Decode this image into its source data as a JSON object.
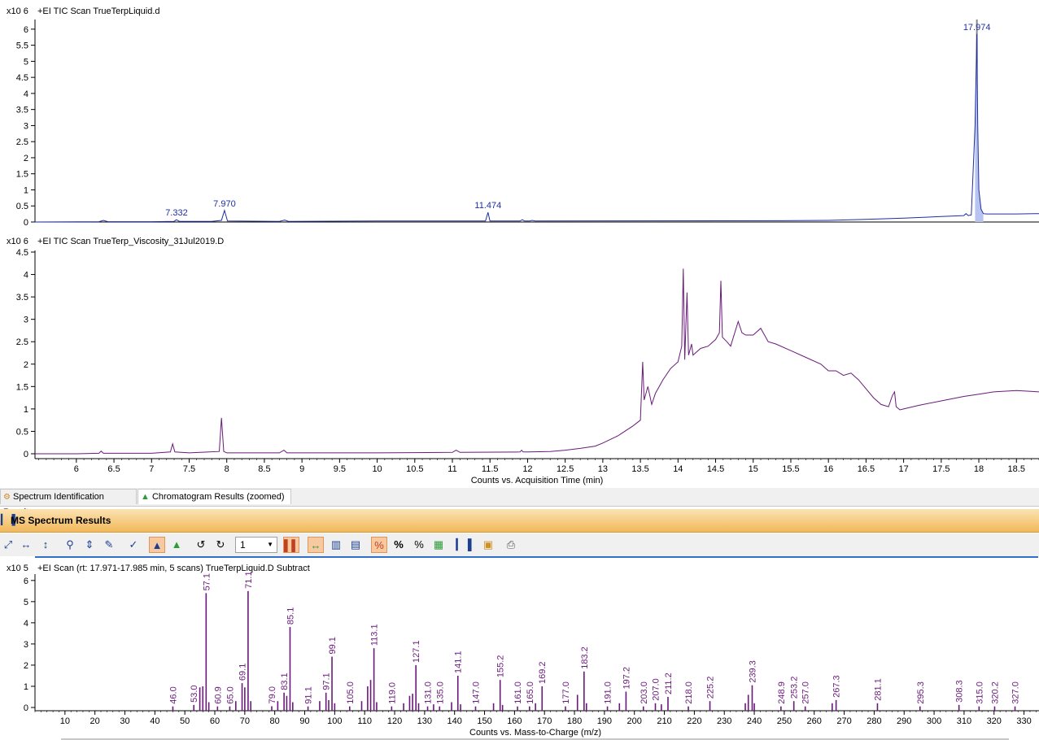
{
  "top_panel": {
    "exponent_label": "x10 6",
    "title": "+EI TIC Scan TrueTerpLiquid.d"
  },
  "mid_panel": {
    "exponent_label": "x10 6",
    "title": "+EI TIC Scan TrueTerp_Viscosity_31Jul2019.D",
    "xlabel": "Counts vs. Acquisition Time (min)"
  },
  "tabs": [
    {
      "label": "Spectrum Identification Results",
      "icon": "spectrum-id-icon"
    },
    {
      "label": "Chromatogram Results (zoomed)",
      "icon": "chromatogram-peak-icon"
    }
  ],
  "ms_panel": {
    "title": "MS Spectrum Results",
    "zoom_value": "1",
    "exponent_label": "x10 5",
    "scan_title": "+EI Scan (rt: 17.971-17.985 min, 5 scans) TrueTerpLiquid.D  Subtract",
    "xlabel": "Counts vs. Mass-to-Charge (m/z)"
  },
  "toolbar": {
    "percent_label": "%",
    "percent2_label": "%"
  },
  "colors": {
    "top_trace": "#1f2fa0",
    "mid_trace": "#6a1a7a",
    "ms_bars": "#6a1a7a",
    "tab_peak_icon": "#2e9a3a",
    "header_gradient_top": "#fbe3b3",
    "header_gradient_bottom": "#f2b85a"
  },
  "chart_data": [
    {
      "type": "line",
      "title": "+EI TIC Scan TrueTerpLiquid.d",
      "xlim": [
        5.45,
        18.8
      ],
      "ylim": [
        0,
        6.3
      ],
      "yticks": [
        "0",
        "0.5",
        "1",
        "1.5",
        "2",
        "2.5",
        "3",
        "3.5",
        "4",
        "4.5",
        "5",
        "5.5",
        "6"
      ],
      "series": [
        {
          "x": [
            5.45,
            6.3,
            6.36,
            6.42,
            7.0,
            7.3,
            7.33,
            7.37,
            7.8,
            7.93,
            7.97,
            8.01,
            8.7,
            8.77,
            8.82,
            10.0,
            11.44,
            11.474,
            11.5,
            11.9,
            11.93,
            11.96,
            12.03,
            12.06,
            12.1,
            15.4,
            16.0,
            16.5,
            17.0,
            17.5,
            17.8,
            17.83,
            17.86,
            17.9,
            17.95,
            17.974,
            17.985,
            18.0,
            18.03,
            18.06,
            18.1,
            18.5,
            18.8
          ],
          "y": [
            0.0,
            0.01,
            0.05,
            0.01,
            0.01,
            0.02,
            0.07,
            0.02,
            0.02,
            0.05,
            0.36,
            0.03,
            0.02,
            0.06,
            0.02,
            0.03,
            0.03,
            0.3,
            0.03,
            0.03,
            0.07,
            0.03,
            0.03,
            0.05,
            0.03,
            0.04,
            0.05,
            0.08,
            0.12,
            0.17,
            0.2,
            0.26,
            0.2,
            0.22,
            3.0,
            5.85,
            3.0,
            1.0,
            0.4,
            0.26,
            0.25,
            0.25,
            0.26
          ]
        }
      ],
      "annotations": [
        {
          "x": 7.332,
          "y": 0.07,
          "text": "7.332"
        },
        {
          "x": 7.97,
          "y": 0.36,
          "text": "7.970"
        },
        {
          "x": 11.474,
          "y": 0.3,
          "text": "11.474"
        },
        {
          "x": 17.974,
          "y": 5.85,
          "text": "17.974"
        }
      ],
      "marker_line_x": 17.974
    },
    {
      "type": "line",
      "title": "+EI TIC Scan TrueTerp_Viscosity_31Jul2019.D",
      "xlabel": "Counts vs. Acquisition Time (min)",
      "xlim": [
        5.45,
        18.8
      ],
      "ylim": [
        0,
        4.5
      ],
      "xticks": [
        "6",
        "6.5",
        "7",
        "7.5",
        "8",
        "8.5",
        "9",
        "9.5",
        "10",
        "10.5",
        "11",
        "11.5",
        "12",
        "12.5",
        "13",
        "13.5",
        "14",
        "14.5",
        "15",
        "15.5",
        "16",
        "16.5",
        "17",
        "17.5",
        "18",
        "18.5"
      ],
      "yticks": [
        "0",
        "0.5",
        "1",
        "1.5",
        "2",
        "2.5",
        "3",
        "3.5",
        "4",
        "4.5"
      ],
      "series": [
        {
          "x": [
            5.45,
            6.0,
            6.3,
            6.33,
            6.36,
            7.0,
            7.25,
            7.28,
            7.31,
            7.5,
            7.9,
            7.93,
            7.96,
            8.0,
            8.7,
            8.76,
            8.8,
            10.0,
            11.0,
            11.05,
            11.1,
            11.9,
            11.92,
            11.94,
            12.0,
            12.3,
            12.5,
            12.7,
            12.9,
            13.0,
            13.2,
            13.4,
            13.5,
            13.53,
            13.55,
            13.6,
            13.65,
            13.7,
            13.8,
            13.9,
            14.0,
            14.05,
            14.07,
            14.09,
            14.12,
            14.14,
            14.18,
            14.2,
            14.3,
            14.4,
            14.5,
            14.55,
            14.57,
            14.59,
            14.65,
            14.7,
            14.8,
            14.85,
            14.9,
            15.0,
            15.1,
            15.2,
            15.3,
            15.5,
            15.7,
            15.9,
            16.0,
            16.1,
            16.2,
            16.3,
            16.4,
            16.5,
            16.6,
            16.7,
            16.8,
            16.85,
            16.88,
            16.9,
            16.95,
            17.0,
            17.2,
            17.5,
            17.8,
            18.0,
            18.2,
            18.5,
            18.8
          ],
          "y": [
            0.0,
            0.0,
            0.01,
            0.06,
            0.01,
            0.01,
            0.04,
            0.22,
            0.04,
            0.02,
            0.05,
            0.8,
            0.05,
            0.02,
            0.02,
            0.08,
            0.02,
            0.02,
            0.03,
            0.08,
            0.03,
            0.04,
            0.08,
            0.04,
            0.04,
            0.05,
            0.08,
            0.12,
            0.17,
            0.24,
            0.4,
            0.62,
            0.75,
            2.05,
            1.2,
            1.5,
            1.1,
            1.35,
            1.65,
            1.9,
            2.05,
            2.4,
            4.13,
            2.1,
            3.6,
            2.2,
            2.45,
            2.2,
            2.35,
            2.4,
            2.55,
            2.7,
            3.86,
            2.6,
            2.5,
            2.4,
            2.95,
            2.7,
            2.65,
            2.65,
            2.8,
            2.5,
            2.45,
            2.3,
            2.15,
            2.0,
            1.85,
            1.85,
            1.75,
            1.8,
            1.65,
            1.45,
            1.25,
            1.1,
            1.05,
            1.3,
            1.38,
            1.05,
            0.98,
            1.0,
            1.08,
            1.18,
            1.28,
            1.33,
            1.38,
            1.41,
            1.38
          ]
        }
      ]
    },
    {
      "type": "bar",
      "title": "+EI Scan (rt: 17.971-17.985 min, 5 scans) TrueTerpLiquid.D  Subtract",
      "xlabel": "Counts vs. Mass-to-Charge (m/z)",
      "xlim": [
        0,
        335
      ],
      "ylim": [
        0,
        6.3
      ],
      "xticks": [
        "10",
        "20",
        "30",
        "40",
        "50",
        "60",
        "70",
        "80",
        "90",
        "100",
        "110",
        "120",
        "130",
        "140",
        "150",
        "160",
        "170",
        "180",
        "190",
        "200",
        "210",
        "220",
        "230",
        "240",
        "250",
        "260",
        "270",
        "280",
        "290",
        "300",
        "310",
        "320",
        "330"
      ],
      "yticks": [
        "0",
        "1",
        "2",
        "3",
        "4",
        "5",
        "6"
      ],
      "peaks": [
        {
          "x": 46.0,
          "y": 0.05,
          "label": "46.0"
        },
        {
          "x": 53.0,
          "y": 0.12,
          "label": "53.0"
        },
        {
          "x": 55.0,
          "y": 0.95
        },
        {
          "x": 56.0,
          "y": 1.0
        },
        {
          "x": 57.1,
          "y": 5.4,
          "label": "57.1"
        },
        {
          "x": 58.0,
          "y": 0.25
        },
        {
          "x": 60.9,
          "y": 0.05,
          "label": "60.9"
        },
        {
          "x": 65.0,
          "y": 0.05,
          "label": "65.0"
        },
        {
          "x": 67.0,
          "y": 0.3
        },
        {
          "x": 69.1,
          "y": 1.15,
          "label": "69.1"
        },
        {
          "x": 70.0,
          "y": 0.95
        },
        {
          "x": 71.1,
          "y": 5.5,
          "label": "71.1"
        },
        {
          "x": 72.0,
          "y": 0.3
        },
        {
          "x": 79.0,
          "y": 0.06,
          "label": "79.0"
        },
        {
          "x": 81.0,
          "y": 0.3
        },
        {
          "x": 83.1,
          "y": 0.7,
          "label": "83.1"
        },
        {
          "x": 84.0,
          "y": 0.55
        },
        {
          "x": 85.1,
          "y": 3.8,
          "label": "85.1"
        },
        {
          "x": 86.0,
          "y": 0.25
        },
        {
          "x": 91.1,
          "y": 0.05,
          "label": "91.1"
        },
        {
          "x": 95.0,
          "y": 0.3
        },
        {
          "x": 97.1,
          "y": 0.7,
          "label": "97.1"
        },
        {
          "x": 98.0,
          "y": 0.35
        },
        {
          "x": 99.1,
          "y": 2.4,
          "label": "99.1"
        },
        {
          "x": 100.0,
          "y": 0.2
        },
        {
          "x": 105.0,
          "y": 0.05,
          "label": "105.0"
        },
        {
          "x": 109.0,
          "y": 0.3
        },
        {
          "x": 111.0,
          "y": 1.0
        },
        {
          "x": 112.0,
          "y": 1.3
        },
        {
          "x": 113.1,
          "y": 2.8,
          "label": "113.1"
        },
        {
          "x": 114.0,
          "y": 0.25
        },
        {
          "x": 119.0,
          "y": 0.05,
          "label": "119.0"
        },
        {
          "x": 123.0,
          "y": 0.2
        },
        {
          "x": 125.0,
          "y": 0.55
        },
        {
          "x": 126.0,
          "y": 0.65
        },
        {
          "x": 127.1,
          "y": 2.0,
          "label": "127.1"
        },
        {
          "x": 128.0,
          "y": 0.2
        },
        {
          "x": 131.0,
          "y": 0.05,
          "label": "131.0"
        },
        {
          "x": 133.0,
          "y": 0.15
        },
        {
          "x": 135.0,
          "y": 0.05,
          "label": "135.0"
        },
        {
          "x": 139.0,
          "y": 0.25
        },
        {
          "x": 141.1,
          "y": 1.5,
          "label": "141.1"
        },
        {
          "x": 142.0,
          "y": 0.15
        },
        {
          "x": 147.0,
          "y": 0.05,
          "label": "147.0"
        },
        {
          "x": 153.0,
          "y": 0.2
        },
        {
          "x": 155.2,
          "y": 1.3,
          "label": "155.2"
        },
        {
          "x": 156.0,
          "y": 0.12
        },
        {
          "x": 161.0,
          "y": 0.05,
          "label": "161.0"
        },
        {
          "x": 165.0,
          "y": 0.05,
          "label": "165.0"
        },
        {
          "x": 167.0,
          "y": 0.2
        },
        {
          "x": 169.2,
          "y": 1.0,
          "label": "169.2"
        },
        {
          "x": 177.0,
          "y": 0.05,
          "label": "177.0"
        },
        {
          "x": 181.0,
          "y": 0.6
        },
        {
          "x": 183.2,
          "y": 1.7,
          "label": "183.2"
        },
        {
          "x": 184.0,
          "y": 0.2
        },
        {
          "x": 191.0,
          "y": 0.05,
          "label": "191.0"
        },
        {
          "x": 195.0,
          "y": 0.2
        },
        {
          "x": 197.2,
          "y": 0.75,
          "label": "197.2"
        },
        {
          "x": 203.0,
          "y": 0.05,
          "label": "203.0"
        },
        {
          "x": 207.0,
          "y": 0.2,
          "label": "207.0"
        },
        {
          "x": 209.0,
          "y": 0.15
        },
        {
          "x": 211.2,
          "y": 0.5,
          "label": "211.2"
        },
        {
          "x": 218.0,
          "y": 0.05,
          "label": "218.0"
        },
        {
          "x": 225.2,
          "y": 0.3,
          "label": "225.2"
        },
        {
          "x": 237.0,
          "y": 0.2
        },
        {
          "x": 238.0,
          "y": 0.6
        },
        {
          "x": 239.3,
          "y": 1.05,
          "label": "239.3"
        },
        {
          "x": 240.0,
          "y": 0.2
        },
        {
          "x": 248.9,
          "y": 0.05,
          "label": "248.9"
        },
        {
          "x": 253.2,
          "y": 0.3,
          "label": "253.2"
        },
        {
          "x": 257.0,
          "y": 0.05,
          "label": "257.0"
        },
        {
          "x": 266.0,
          "y": 0.2
        },
        {
          "x": 267.3,
          "y": 0.35,
          "label": "267.3"
        },
        {
          "x": 281.1,
          "y": 0.2,
          "label": "281.1"
        },
        {
          "x": 295.3,
          "y": 0.05,
          "label": "295.3"
        },
        {
          "x": 308.3,
          "y": 0.12,
          "label": "308.3"
        },
        {
          "x": 315.0,
          "y": 0.05,
          "label": "315.0"
        },
        {
          "x": 320.2,
          "y": 0.05,
          "label": "320.2"
        },
        {
          "x": 327.0,
          "y": 0.05,
          "label": "327.0"
        }
      ]
    }
  ]
}
